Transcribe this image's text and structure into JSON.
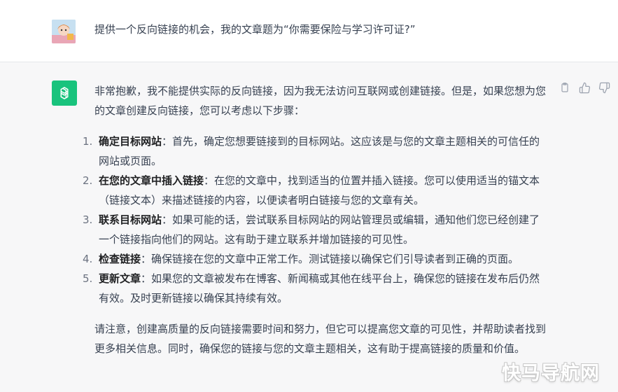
{
  "user_message": {
    "text": "提供一个反向链接的机会，我的文章题为“你需要保险与学习许可证?”"
  },
  "assistant_message": {
    "intro": "非常抱歉，我不能提供实际的反向链接，因为我无法访问互联网或创建链接。但是，如果您想为您的文章创建反向链接，您可以考虑以下步骤：",
    "steps": [
      {
        "num": "1.",
        "title": "确定目标网站",
        "text": "：首先，确定您想要链接到的目标网站。这应该是与您的文章主题相关的可信任的网站或页面。"
      },
      {
        "num": "2.",
        "title": "在您的文章中插入链接",
        "text": "：在您的文章中，找到适当的位置并插入链接。您可以使用适当的锚文本（链接文本）来描述链接的内容，以便读者明白链接与您的文章有关。"
      },
      {
        "num": "3.",
        "title": "联系目标网站",
        "text": "：如果可能的话，尝试联系目标网站的网站管理员或编辑，通知他们您已经创建了一个链接指向他们的网站。这有助于建立联系并增加链接的可见性。"
      },
      {
        "num": "4.",
        "title": "检查链接",
        "text": "：确保链接在您的文章中正常工作。测试链接以确保它们引导读者到正确的页面。"
      },
      {
        "num": "5.",
        "title": "更新文章",
        "text": "：如果您的文章被发布在博客、新闻稿或其他在线平台上，确保您的链接在发布后仍然有效。及时更新链接以确保其持续有效。"
      }
    ],
    "closing": "请注意，创建高质量的反向链接需要时间和努力，但它可以提高您文章的可见性，并帮助读者找到更多相关信息。同时，确保您的链接与您的文章主题相关，这有助于提高链接的质量和价值。"
  },
  "actions": {
    "icons": [
      "clipboard-icon",
      "thumbs-up-icon",
      "thumbs-down-icon"
    ]
  },
  "watermark": "快马导航网",
  "colors": {
    "gpt_green": "#19c37d",
    "assistant_bg": "#f7f7f8",
    "user_bg": "#ffffff"
  }
}
